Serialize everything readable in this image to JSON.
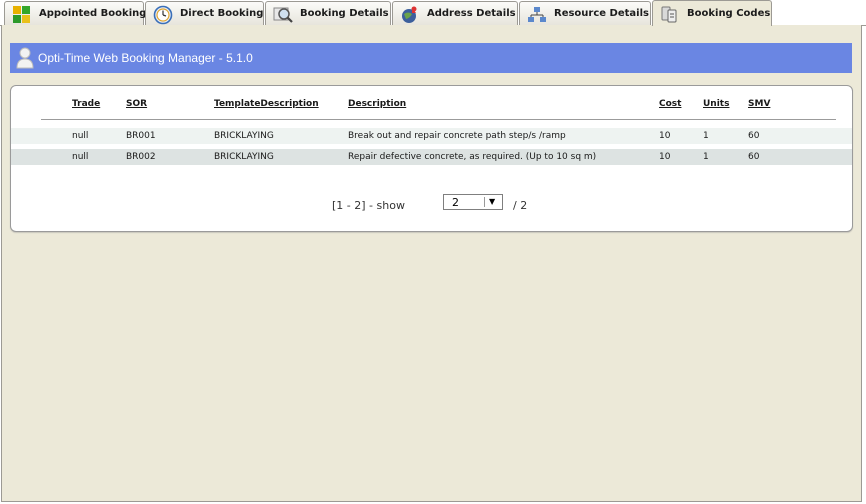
{
  "tabs": [
    {
      "label": "Appointed Booking",
      "icon": "grid-colors-icon"
    },
    {
      "label": "Direct Booking",
      "icon": "clock-icon"
    },
    {
      "label": "Booking Details",
      "icon": "magnifier-icon"
    },
    {
      "label": "Address Details",
      "icon": "globe-pin-icon"
    },
    {
      "label": "Resource Details",
      "icon": "network-icon"
    },
    {
      "label": "Booking Codes",
      "icon": "codes-icon"
    }
  ],
  "active_tab": "Booking Codes",
  "header": {
    "title": "Opti-Time Web Booking Manager - 5.1.0",
    "icon": "user-icon"
  },
  "table": {
    "columns": [
      "Trade",
      "SOR",
      "TemplateDescription",
      "Description",
      "Cost",
      "Units",
      "SMV"
    ],
    "rows": [
      [
        "null",
        "BR001",
        "BRICKLAYING",
        "Break out and repair concrete path step/s /ramp",
        "10",
        "1",
        "60"
      ],
      [
        "null",
        "BR002",
        "BRICKLAYING",
        "Repair defective concrete, as required. (Up to 10 sq m)",
        "10",
        "1",
        "60"
      ]
    ]
  },
  "pager": {
    "range_text": "[1 - 2] - show",
    "page_size": "2",
    "total_text": "/ 2"
  },
  "colors": {
    "header_bg": "#6a86e3",
    "panel_bg": "#ece9d8",
    "row_even": "#eef3f1",
    "row_odd": "#dde3e2"
  }
}
